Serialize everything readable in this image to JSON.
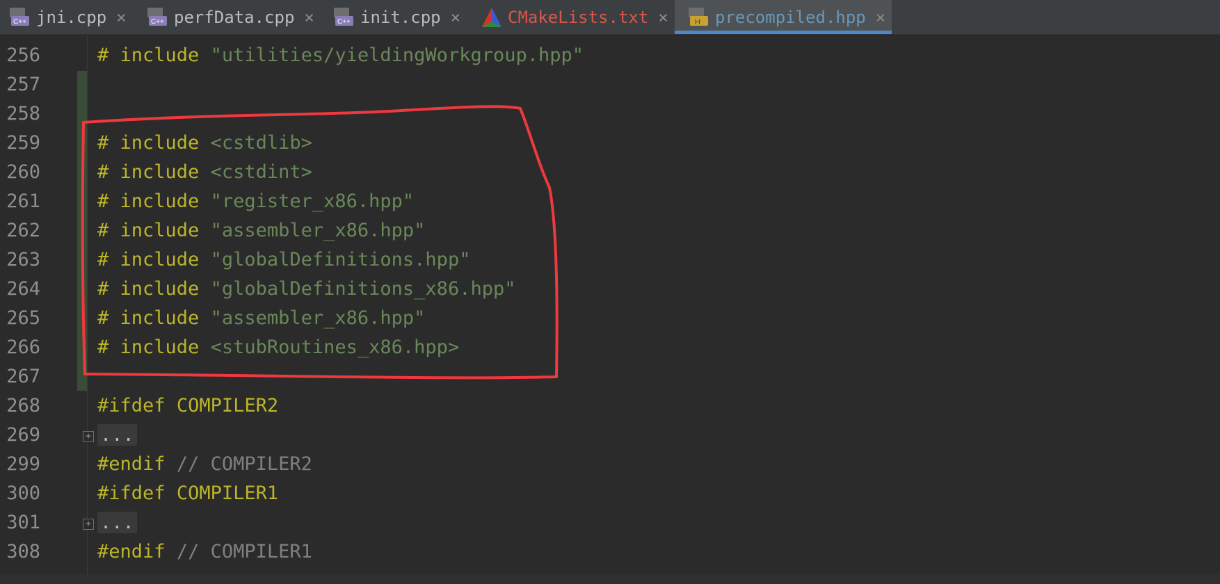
{
  "tabs": [
    {
      "label": "jni.cpp",
      "icon": "cpp-file-icon",
      "color": "#bbbbbb"
    },
    {
      "label": "perfData.cpp",
      "icon": "cpp-file-icon",
      "color": "#bbbbbb"
    },
    {
      "label": "init.cpp",
      "icon": "cpp-file-icon",
      "color": "#bbbbbb"
    },
    {
      "label": "CMakeLists.txt",
      "icon": "cmake-icon",
      "color": "#d9574a"
    },
    {
      "label": "precompiled.hpp",
      "icon": "header-file-icon",
      "color": "#6897bb",
      "active": true
    }
  ],
  "close_glyph": "×",
  "cpp_icon_text": "C++",
  "header_icon_text": "H",
  "lines": [
    {
      "no": "256",
      "hash": "# ",
      "kw": "include",
      "sp": " ",
      "arg": "\"utilities/yieldingWorkgroup.hpp\""
    },
    {
      "no": "257"
    },
    {
      "no": "258"
    },
    {
      "no": "259",
      "hash": "# ",
      "kw": "include",
      "sp": " ",
      "arg": "<cstdlib>"
    },
    {
      "no": "260",
      "hash": "# ",
      "kw": "include",
      "sp": " ",
      "arg": "<cstdint>"
    },
    {
      "no": "261",
      "hash": "# ",
      "kw": "include",
      "sp": " ",
      "arg": "\"register_x86.hpp\""
    },
    {
      "no": "262",
      "hash": "# ",
      "kw": "include",
      "sp": " ",
      "arg": "\"assembler_x86.hpp\""
    },
    {
      "no": "263",
      "hash": "# ",
      "kw": "include",
      "sp": " ",
      "arg": "\"globalDefinitions.hpp\""
    },
    {
      "no": "264",
      "hash": "# ",
      "kw": "include",
      "sp": " ",
      "arg": "\"globalDefinitions_x86.hpp\""
    },
    {
      "no": "265",
      "hash": "# ",
      "kw": "include",
      "sp": " ",
      "arg": "\"assembler_x86.hpp\""
    },
    {
      "no": "266",
      "hash": "# ",
      "kw": "include",
      "sp": " ",
      "arg": "<stubRoutines_x86.hpp>"
    },
    {
      "no": "267"
    },
    {
      "no": "268",
      "directive": "#ifdef",
      "sp": " ",
      "macro": "COMPILER2"
    },
    {
      "no": "269",
      "fold": "..."
    },
    {
      "no": "299",
      "directive": "#endif",
      "sp": " ",
      "comment": "// COMPILER2"
    },
    {
      "no": "300",
      "directive": "#ifdef",
      "sp": " ",
      "macro": "COMPILER1"
    },
    {
      "no": "301",
      "fold": "..."
    },
    {
      "no": "308",
      "directive": "#endif",
      "sp": " ",
      "comment": "// COMPILER1"
    }
  ],
  "annotation_color": "#f0393f"
}
